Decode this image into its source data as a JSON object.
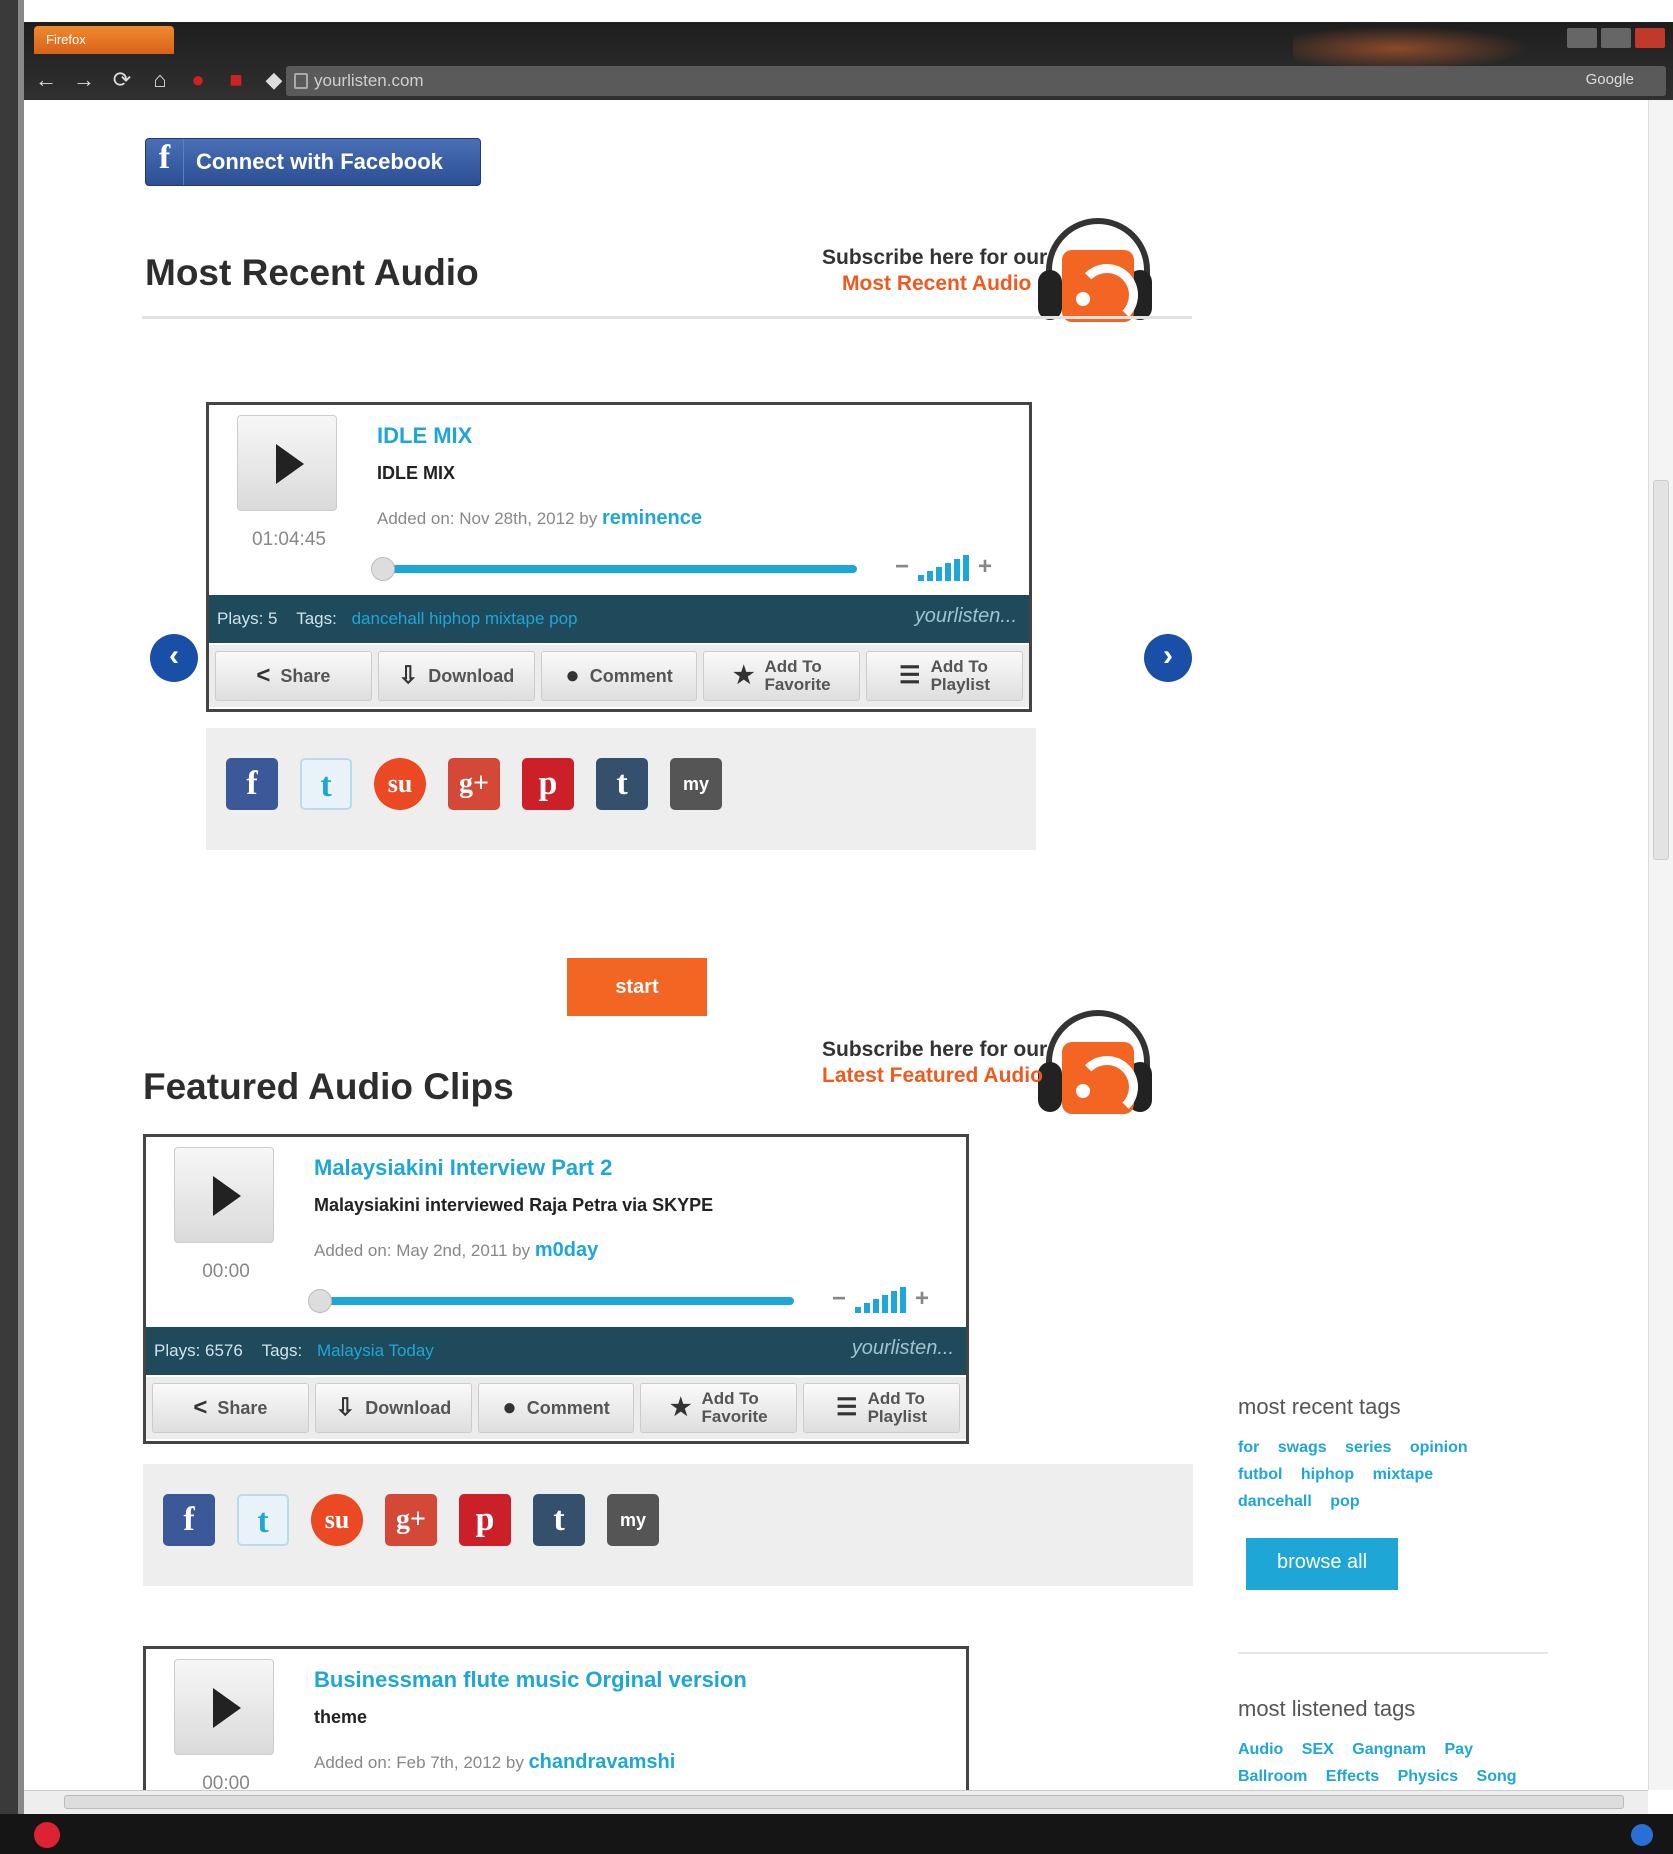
{
  "browser": {
    "app_tab": "Firefox",
    "url": "yourlisten.com",
    "search_engine": "Google"
  },
  "connect": {
    "label": "Connect with Facebook"
  },
  "recent": {
    "title": "Most Recent Audio",
    "subscribe_line1": "Subscribe here for our",
    "subscribe_line2": "Most Recent Audio"
  },
  "start": {
    "label": "start"
  },
  "featured": {
    "title": "Featured Audio Clips",
    "subscribe_line1": "Subscribe here for our",
    "subscribe_line2": "Latest Featured Audio"
  },
  "players": [
    {
      "title": "IDLE MIX",
      "subtitle": "IDLE MIX",
      "added_prefix": "Added on: Nov 28th, 2012 by",
      "author": "reminence",
      "time": "01:04:45",
      "plays": "Plays: 5",
      "tags_label": "Tags:",
      "tags": "dancehall hiphop mixtape pop",
      "brand": "yourlisten..."
    },
    {
      "title": "Malaysiakini Interview Part 2",
      "subtitle": "Malaysiakini interviewed Raja Petra via SKYPE",
      "added_prefix": "Added on: May 2nd, 2011 by",
      "author": "m0day",
      "time": "00:00",
      "plays": "Plays: 6576",
      "tags_label": "Tags:",
      "tags": "Malaysia Today",
      "brand": "yourlisten..."
    },
    {
      "title": "Businessman flute music Orginal version",
      "subtitle": "theme",
      "added_prefix": "Added on: Feb 7th, 2012 by",
      "author": "chandravamshi",
      "time": "00:00"
    }
  ],
  "actions": {
    "share": "Share",
    "download": "Download",
    "comment": "Comment",
    "fav1": "Add To",
    "fav2": "Favorite",
    "pl1": "Add To",
    "pl2": "Playlist"
  },
  "social_icons": [
    "facebook-icon",
    "twitter-icon",
    "stumbleupon-icon",
    "google-plus-icon",
    "pinterest-icon",
    "tumblr-icon",
    "myspace-icon"
  ],
  "sidebar": {
    "recent_tags_title": "most recent tags",
    "recent_tags": [
      "for",
      "swags",
      "series",
      "opinion",
      "futbol",
      "hiphop",
      "mixtape",
      "dancehall",
      "pop"
    ],
    "browse_all": "browse all",
    "listened_tags_title": "most listened tags",
    "listened_tags": [
      "Audio",
      "SEX",
      "Gangnam",
      "Pay",
      "Ballroom",
      "Effects",
      "Physics",
      "Song"
    ]
  },
  "colors": {
    "accent_blue": "#1ea7d6",
    "accent_orange": "#f26522",
    "player_bar": "#1f4a5c",
    "facebook": "#3b5998"
  }
}
